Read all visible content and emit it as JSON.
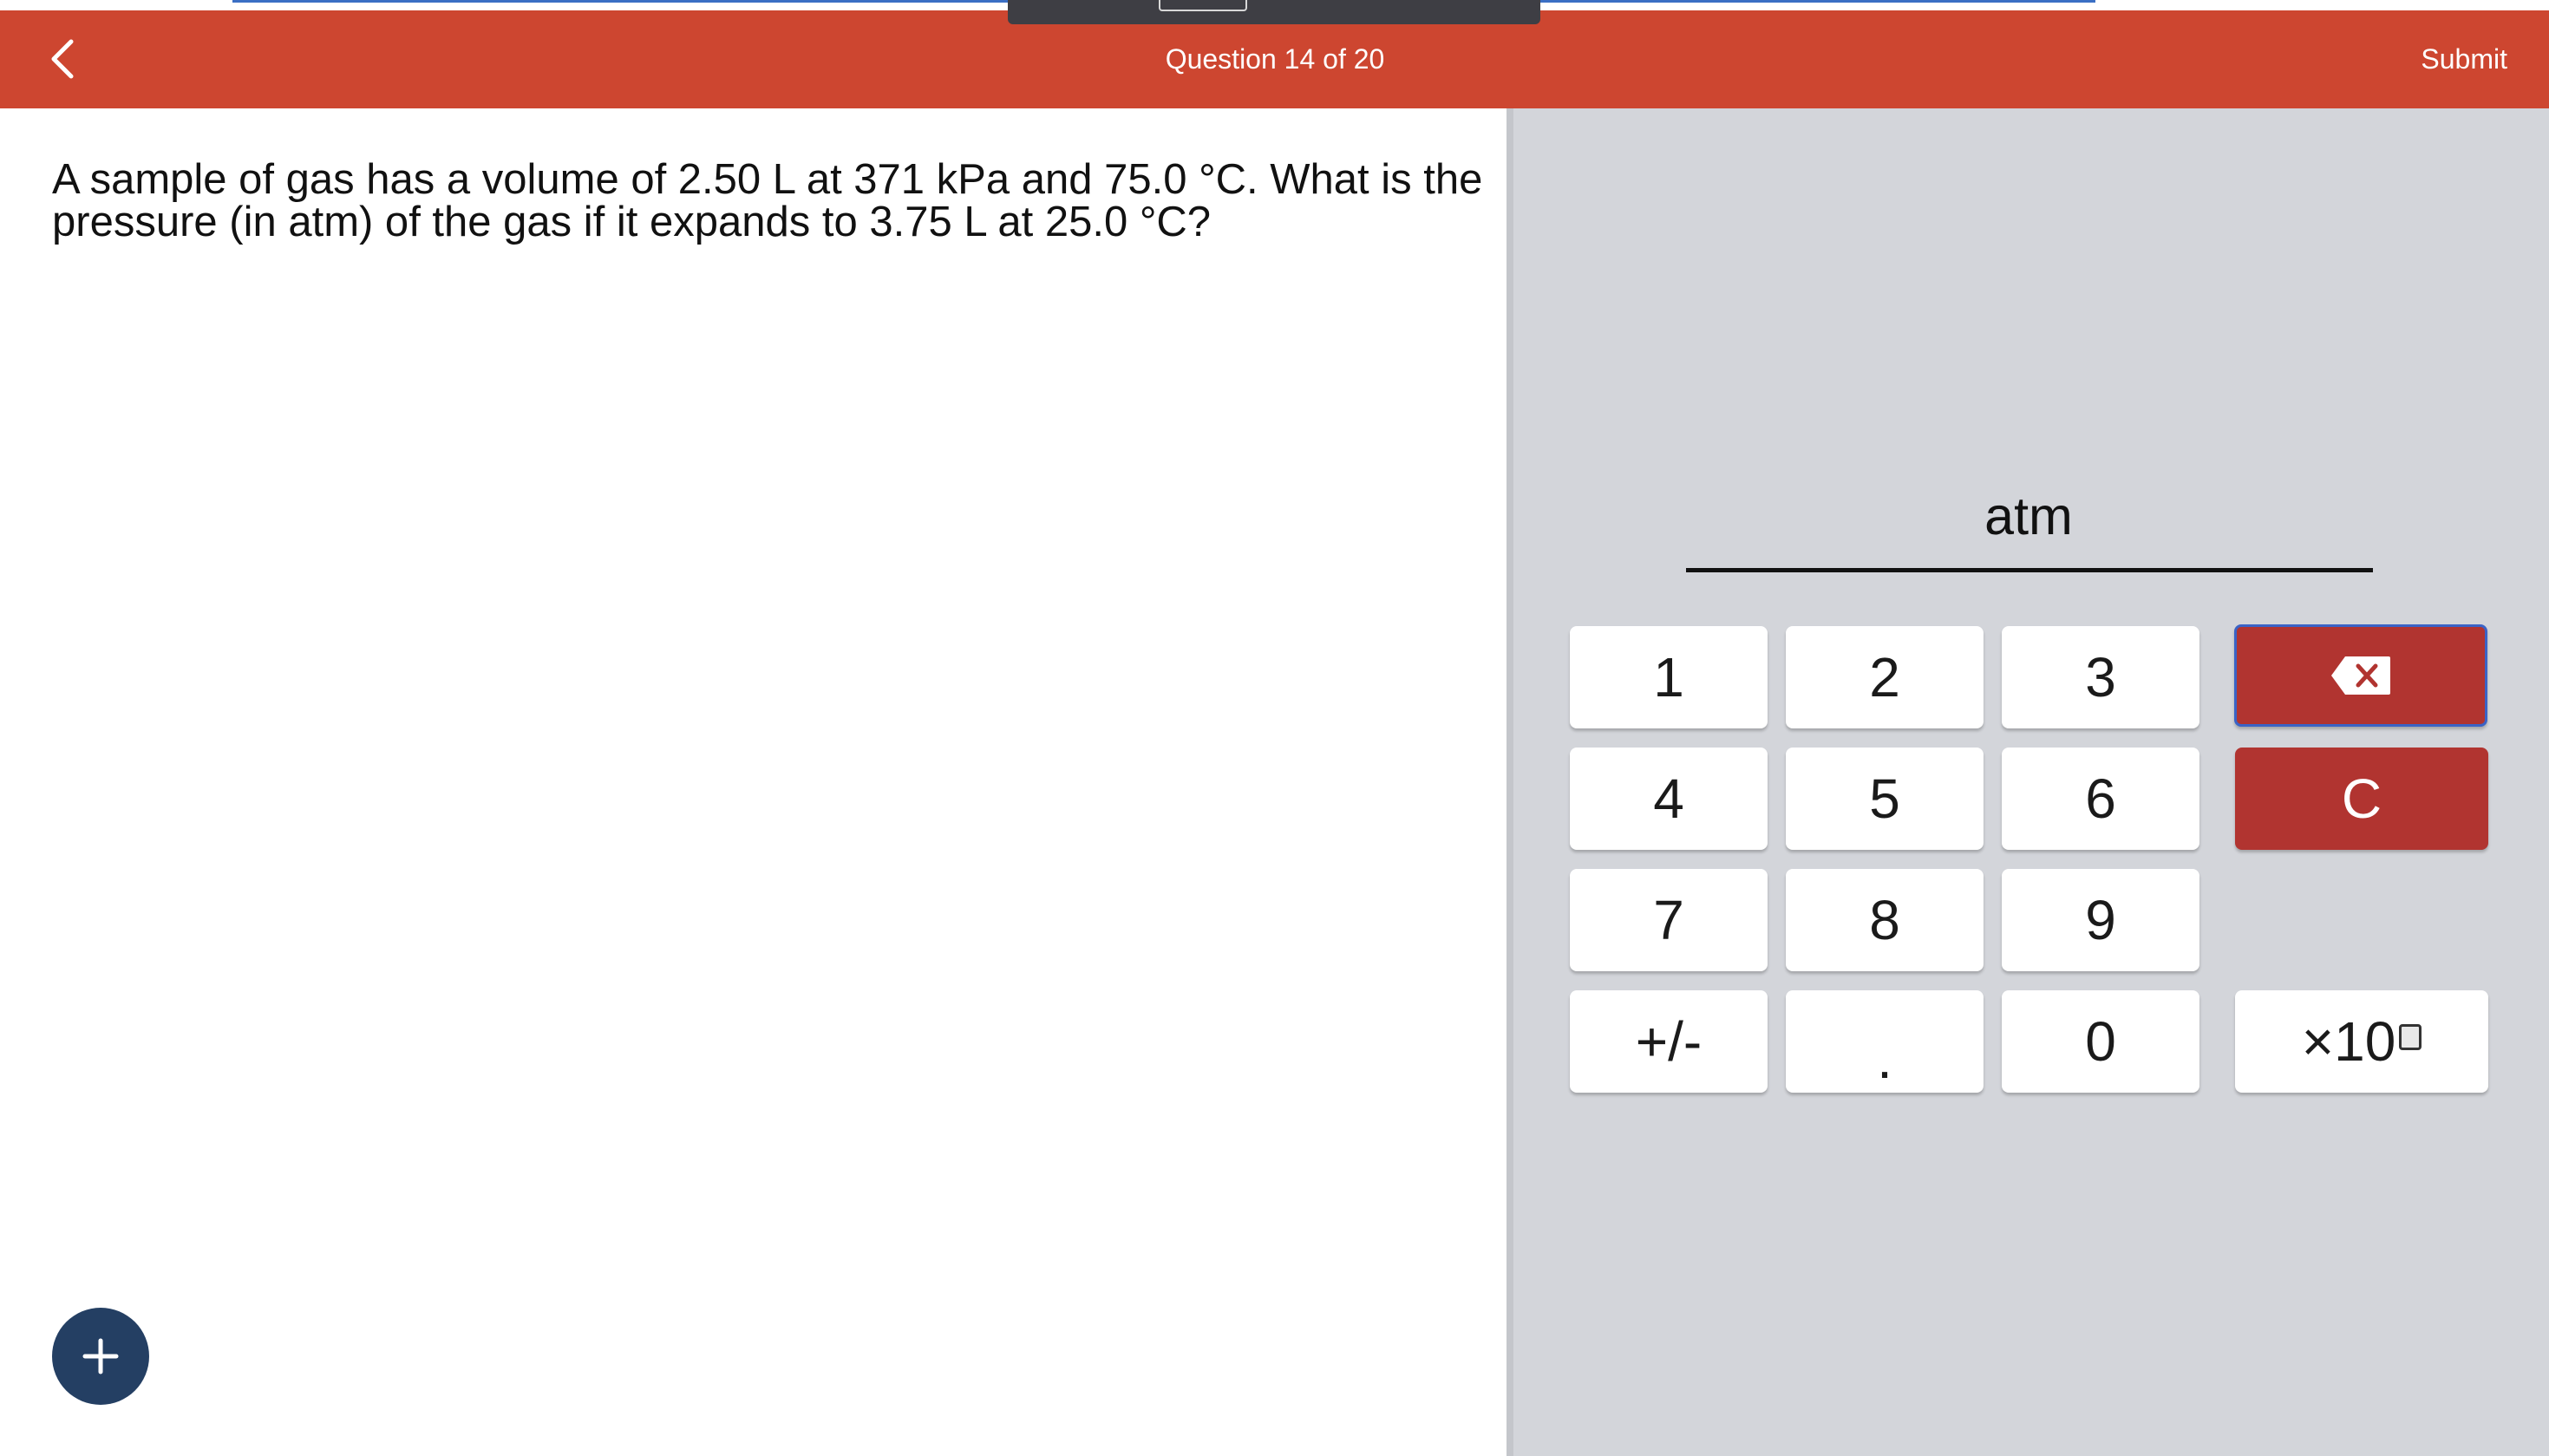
{
  "header": {
    "back_icon": "chevron-left-icon",
    "title": "Question 14 of 20",
    "submit_label": "Submit",
    "background_color": "#cd4630"
  },
  "question": {
    "line1": "A sample of gas has a volume of 2.50 L at 371 kPa and 75.0 °C. What is the",
    "line2": "pressure (in atm) of the gas if it expands to 3.75 L at 25.0 °C?"
  },
  "answer": {
    "value": "",
    "unit": "atm"
  },
  "keypad": {
    "keys": [
      "1",
      "2",
      "3",
      "4",
      "5",
      "6",
      "7",
      "8",
      "9",
      "+/-",
      ".",
      "0"
    ],
    "backspace_icon": "backspace-icon",
    "clear_label": "C",
    "sci_label": "×10",
    "accent_color": "#b13430"
  },
  "fab": {
    "icon": "plus-icon",
    "color": "#243f63"
  }
}
